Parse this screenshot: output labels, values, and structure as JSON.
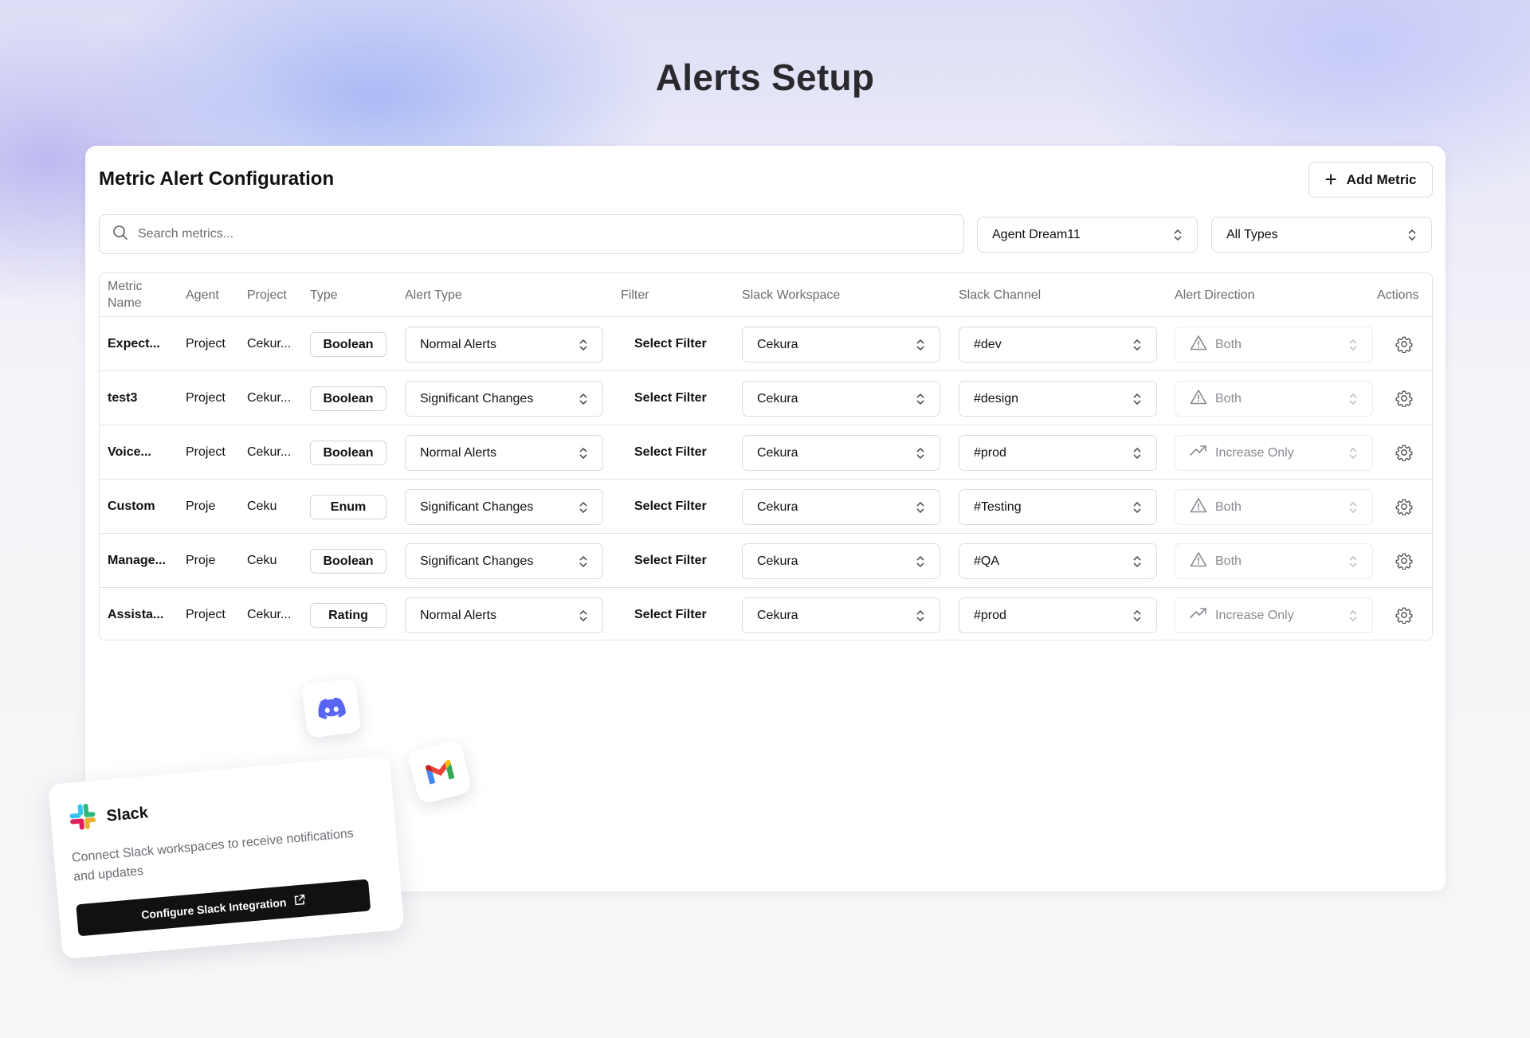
{
  "page": {
    "title": "Alerts Setup"
  },
  "card": {
    "title": "Metric Alert Configuration",
    "add_button": "Add Metric",
    "search_placeholder": "Search metrics...",
    "agent_filter": "Agent Dream11",
    "type_filter": "All Types"
  },
  "table": {
    "headers": {
      "metric_name": "Metric Name",
      "agent": "Agent",
      "project": "Project",
      "type": "Type",
      "alert_type": "Alert Type",
      "filter": "Filter",
      "slack_workspace": "Slack Workspace",
      "slack_channel": "Slack Channel",
      "alert_direction": "Alert Direction",
      "actions": "Actions"
    },
    "rows": [
      {
        "name": "Expect...",
        "agent": "Project",
        "project": "Cekur...",
        "type": "Boolean",
        "alert_type": "Normal Alerts",
        "filter": "Select Filter",
        "workspace": "Cekura",
        "channel": "#dev",
        "direction": "Both",
        "direction_icon": "warning-icon"
      },
      {
        "name": "test3",
        "agent": "Project",
        "project": "Cekur...",
        "type": "Boolean",
        "alert_type": "Significant Changes",
        "filter": "Select Filter",
        "workspace": "Cekura",
        "channel": "#design",
        "direction": "Both",
        "direction_icon": "warning-icon"
      },
      {
        "name": "Voice...",
        "agent": "Project",
        "project": "Cekur...",
        "type": "Boolean",
        "alert_type": "Normal Alerts",
        "filter": "Select Filter",
        "workspace": "Cekura",
        "channel": "#prod",
        "direction": "Increase Only",
        "direction_icon": "trend-up-icon"
      },
      {
        "name": "Custom",
        "agent": "Proje",
        "project": "Ceku",
        "type": "Enum",
        "alert_type": "Significant Changes",
        "filter": "Select Filter",
        "workspace": "Cekura",
        "channel": "#Testing",
        "direction": "Both",
        "direction_icon": "warning-icon"
      },
      {
        "name": "Manage...",
        "agent": "Proje",
        "project": "Ceku",
        "type": "Boolean",
        "alert_type": "Significant Changes",
        "filter": "Select Filter",
        "workspace": "Cekura",
        "channel": "#QA",
        "direction": "Both",
        "direction_icon": "warning-icon"
      },
      {
        "name": "Assista...",
        "agent": "Project",
        "project": "Cekur...",
        "type": "Rating",
        "alert_type": "Normal Alerts",
        "filter": "Select Filter",
        "workspace": "Cekura",
        "channel": "#prod",
        "direction": "Increase Only",
        "direction_icon": "trend-up-icon"
      }
    ]
  },
  "floating": {
    "discord_icon": "discord-icon",
    "gmail_icon": "gmail-icon"
  },
  "slack_card": {
    "title": "Slack",
    "description": "Connect Slack workspaces to receive notifications and updates",
    "button": "Configure Slack Integration"
  }
}
